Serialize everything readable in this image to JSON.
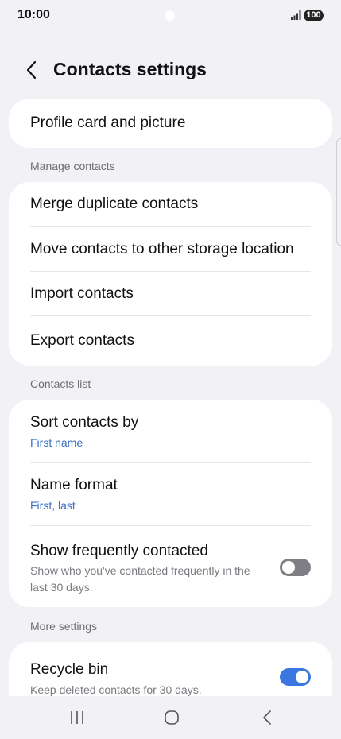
{
  "status_bar": {
    "time": "10:00",
    "battery": "100"
  },
  "header": {
    "title": "Contacts settings"
  },
  "profile_card": {
    "label": "Profile card and picture"
  },
  "manage_contacts": {
    "header": "Manage contacts",
    "items": [
      {
        "label": "Merge duplicate contacts"
      },
      {
        "label": "Move contacts to other storage location"
      },
      {
        "label": "Import contacts"
      },
      {
        "label": "Export contacts"
      }
    ]
  },
  "contacts_list": {
    "header": "Contacts list",
    "sort": {
      "label": "Sort contacts by",
      "value": "First name"
    },
    "name_format": {
      "label": "Name format",
      "value": "First, last"
    },
    "frequent": {
      "label": "Show frequently contacted",
      "description": "Show who you've contacted frequently in the last 30 days.",
      "enabled": false
    }
  },
  "more_settings": {
    "header": "More settings",
    "recycle_bin": {
      "label": "Recycle bin",
      "description": "Keep deleted contacts for 30 days.",
      "enabled": true
    }
  },
  "colors": {
    "background": "#f2f2f6",
    "card": "#ffffff",
    "accent": "#3a77e0",
    "value_text": "#3a6fc4"
  },
  "icons": [
    "signal-icon",
    "back-icon",
    "recents-icon",
    "home-icon",
    "nav-back-icon"
  ]
}
